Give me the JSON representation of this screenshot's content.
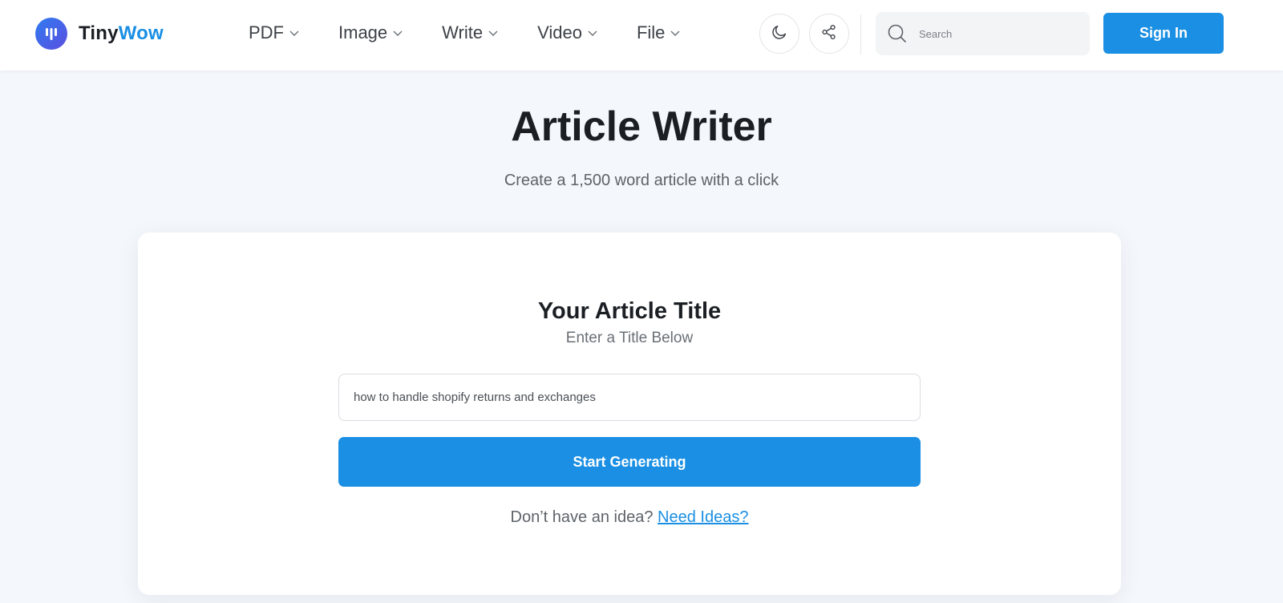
{
  "header": {
    "logo": {
      "part1": "Tiny",
      "part2": "Wow",
      "icon": "tinywow-logo-icon"
    },
    "nav": [
      {
        "label": "PDF",
        "icon": "chevron-down-icon"
      },
      {
        "label": "Image",
        "icon": "chevron-down-icon"
      },
      {
        "label": "Write",
        "icon": "chevron-down-icon"
      },
      {
        "label": "Video",
        "icon": "chevron-down-icon"
      },
      {
        "label": "File",
        "icon": "chevron-down-icon"
      }
    ],
    "theme_toggle_icon": "moon-icon",
    "share_icon": "share-icon",
    "search": {
      "placeholder": "Search",
      "value": "",
      "icon": "search-icon"
    },
    "signin_label": "Sign In"
  },
  "hero": {
    "title": "Article Writer",
    "subtitle": "Create a 1,500 word article with a click"
  },
  "card": {
    "title": "Your Article Title",
    "subtitle": "Enter a Title Below",
    "input_value": "how to handle shopify returns and exchanges",
    "button_label": "Start Generating",
    "idea_prompt": "Don’t have an idea?",
    "idea_link": "Need Ideas?"
  },
  "colors": {
    "accent": "#1a8fe3",
    "logo_gradient_start": "#2f7bf0",
    "logo_gradient_end": "#5b4fe0",
    "page_background": "#f4f7fb"
  }
}
